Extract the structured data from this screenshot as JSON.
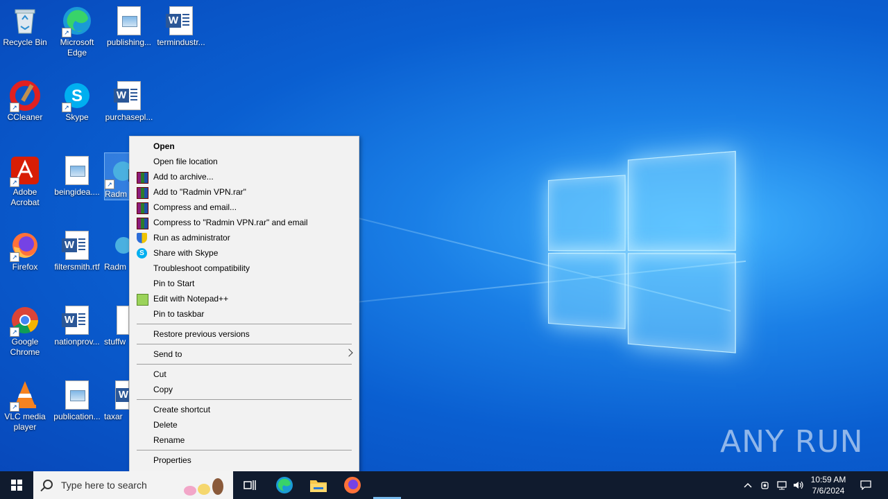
{
  "desktop": {
    "icons": [
      {
        "label": "Recycle Bin"
      },
      {
        "label": "Microsoft Edge"
      },
      {
        "label": "publishing..."
      },
      {
        "label": "termindustr..."
      },
      {
        "label": "CCleaner"
      },
      {
        "label": "Skype"
      },
      {
        "label": "purchasepl..."
      },
      {
        "label": "Adobe Acrobat"
      },
      {
        "label": "beingidea...."
      },
      {
        "label": "Radm"
      },
      {
        "label": "Firefox"
      },
      {
        "label": "filtersmith.rtf"
      },
      {
        "label": "Radm"
      },
      {
        "label": "Google Chrome"
      },
      {
        "label": "nationprov..."
      },
      {
        "label": "stuffw"
      },
      {
        "label": "VLC media player"
      },
      {
        "label": "publication..."
      },
      {
        "label": "taxar"
      }
    ]
  },
  "context_menu": {
    "items": [
      {
        "label": "Open",
        "icon": ""
      },
      {
        "label": "Open file location",
        "icon": ""
      },
      {
        "label": "Add to archive...",
        "icon": "winrar-icon"
      },
      {
        "label": "Add to \"Radmin VPN.rar\"",
        "icon": "winrar-icon"
      },
      {
        "label": "Compress and email...",
        "icon": "winrar-icon"
      },
      {
        "label": "Compress to \"Radmin VPN.rar\" and email",
        "icon": "winrar-icon"
      },
      {
        "label": "Run as administrator",
        "icon": "uac-shield-icon"
      },
      {
        "label": "Share with Skype",
        "icon": "skype-icon"
      },
      {
        "label": "Troubleshoot compatibility",
        "icon": ""
      },
      {
        "label": "Pin to Start",
        "icon": ""
      },
      {
        "label": "Edit with Notepad++",
        "icon": "notepadpp-icon"
      },
      {
        "label": "Pin to taskbar",
        "icon": ""
      },
      {
        "label": "Restore previous versions",
        "icon": ""
      },
      {
        "label": "Send to",
        "icon": ""
      },
      {
        "label": "Cut",
        "icon": ""
      },
      {
        "label": "Copy",
        "icon": ""
      },
      {
        "label": "Create shortcut",
        "icon": ""
      },
      {
        "label": "Delete",
        "icon": ""
      },
      {
        "label": "Rename",
        "icon": ""
      },
      {
        "label": "Properties",
        "icon": ""
      }
    ]
  },
  "taskbar": {
    "search_placeholder": "Type here to search",
    "clock_time": "10:59 AM",
    "clock_date": "7/6/2024"
  },
  "watermark": "ANY RUN",
  "colors": {
    "wallpaper": "#0a5fd1",
    "taskbar": "#101b2e",
    "menu_bg": "#f2f2f2"
  }
}
